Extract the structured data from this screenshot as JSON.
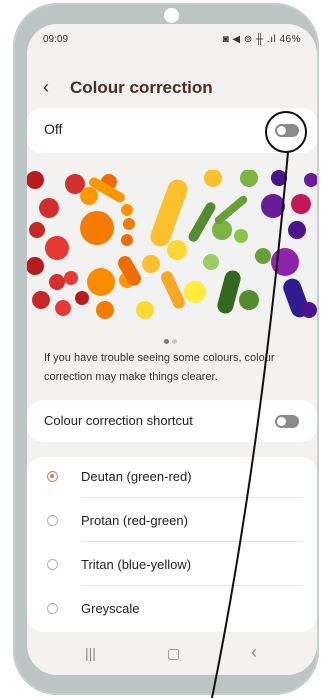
{
  "status_bar": {
    "time": "09:09",
    "icons": "◙ ◀ ⊚ ╫ .ıl",
    "battery": "46%"
  },
  "header": {
    "back_icon": "‹",
    "title": "Colour correction"
  },
  "main_toggle": {
    "label": "Off",
    "state": "off"
  },
  "carousel": {
    "pages": 2,
    "current": 1
  },
  "description": "If you have trouble seeing some colours, colour correction may make things clearer.",
  "shortcut": {
    "label": "Colour correction shortcut",
    "state": "off"
  },
  "options": [
    {
      "label": "Deutan (green-red)",
      "selected": true
    },
    {
      "label": "Protan (red-green)",
      "selected": false
    },
    {
      "label": "Tritan (blue-yellow)",
      "selected": false
    },
    {
      "label": "Greyscale",
      "selected": false
    }
  ],
  "nav": {
    "recents": "|||",
    "home": "▢",
    "back": "‹"
  },
  "colors": {
    "accent": "#e07a4e",
    "title": "#4a2e22",
    "frame": "#bcc5c4"
  }
}
